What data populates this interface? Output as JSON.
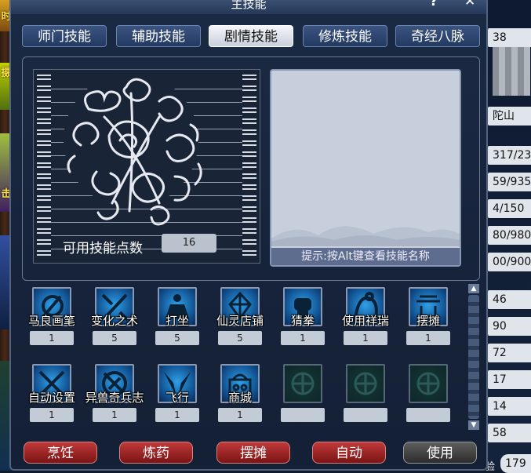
{
  "window": {
    "title": "主技能",
    "help": "?",
    "close": "✕"
  },
  "tabs": [
    {
      "label": "师门技能",
      "active": false
    },
    {
      "label": "辅助技能",
      "active": false
    },
    {
      "label": "剧情技能",
      "active": true
    },
    {
      "label": "修炼技能",
      "active": false
    },
    {
      "label": "奇经八脉",
      "active": false
    }
  ],
  "points": {
    "label": "可用技能点数",
    "value": "16"
  },
  "hint": "提示:按Alt键查看技能名称",
  "skills": [
    {
      "name": "马良画笔",
      "level": "1",
      "icon": "brush-icon"
    },
    {
      "name": "变化之术",
      "level": "5",
      "icon": "transform-icon"
    },
    {
      "name": "打坐",
      "level": "5",
      "icon": "meditate-icon"
    },
    {
      "name": "仙灵店铺",
      "level": "5",
      "icon": "shop-icon"
    },
    {
      "name": "猜拳",
      "level": "1",
      "icon": "fist-icon"
    },
    {
      "name": "使用祥瑞",
      "level": "1",
      "icon": "mount-icon"
    },
    {
      "name": "摆摊",
      "level": "1",
      "icon": "stall-icon"
    },
    {
      "name": "自动设置",
      "level": "1",
      "icon": "auto-icon"
    },
    {
      "name": "异兽奇兵志",
      "level": "1",
      "icon": "book-icon"
    },
    {
      "name": "飞行",
      "level": "1",
      "icon": "wings-icon"
    },
    {
      "name": "商城",
      "level": "1",
      "icon": "mall-icon"
    },
    {
      "name": "",
      "level": "",
      "icon": "empty-slot-icon"
    },
    {
      "name": "",
      "level": "",
      "icon": "empty-slot-icon"
    },
    {
      "name": "",
      "level": "",
      "icon": "empty-slot-icon"
    }
  ],
  "buttons": [
    "烹饪",
    "炼药",
    "摆摊",
    "自动",
    "使用"
  ],
  "attr_panel": {
    "values": [
      "38",
      "",
      "",
      "陀山",
      "317/23",
      "59/935",
      "4/150",
      "80/980",
      "00/900",
      "",
      "46",
      "90",
      "72",
      "17",
      "14",
      "58"
    ],
    "bottom_label": "验",
    "bottom_value": "179"
  },
  "left_strip": {
    "chars": [
      "时",
      "摄",
      "击"
    ]
  },
  "colors": {
    "tab_active": "#f4f6fa",
    "tab_inactive": "#2c4470",
    "button_red": "#a02424",
    "button_use": "#444444",
    "skill_icon": "#2fa0e8"
  }
}
